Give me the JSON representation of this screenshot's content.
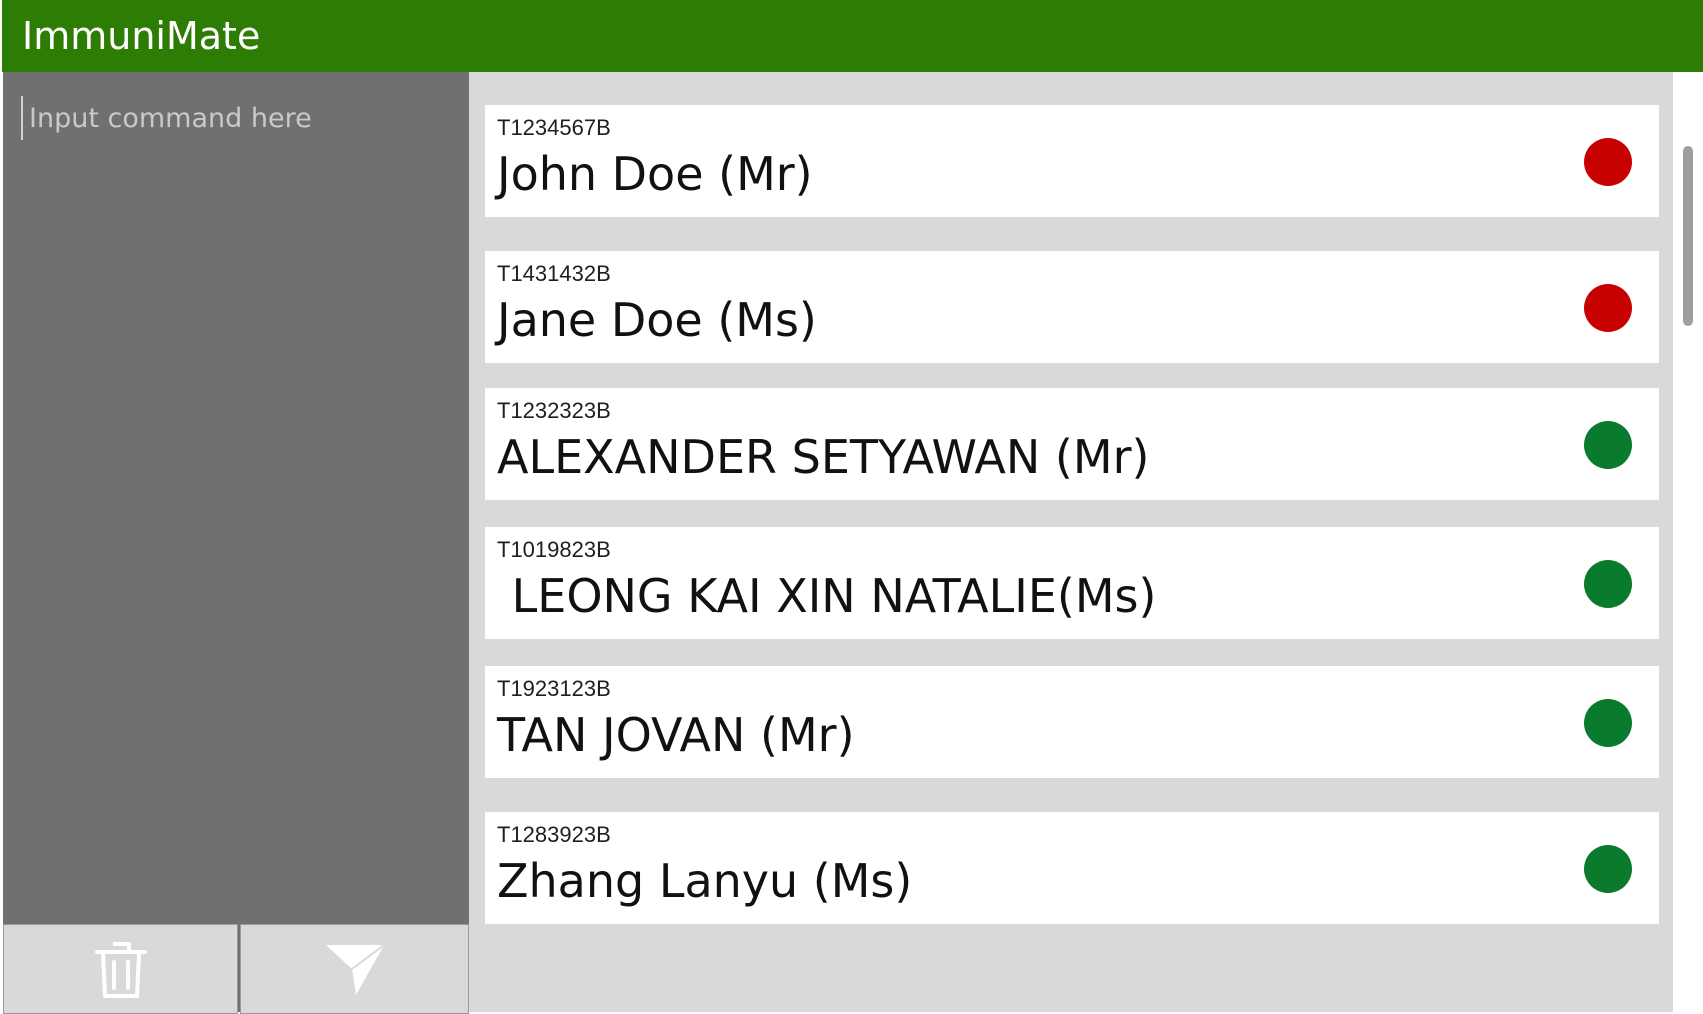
{
  "app": {
    "title": "ImmuniMate"
  },
  "command": {
    "placeholder": "Input command here",
    "value": ""
  },
  "buttons": {
    "clear_icon": "trash-icon",
    "send_icon": "send-icon"
  },
  "colors": {
    "titlebar": "#2d7c03",
    "status_red": "#c70000",
    "status_green": "#0a7a2d"
  },
  "patients": [
    {
      "id": "T1234567B",
      "name": "John Doe (Mr)",
      "status": "red"
    },
    {
      "id": "T1431432B",
      "name": "Jane Doe (Ms)",
      "status": "red"
    },
    {
      "id": "T1232323B",
      "name": "ALEXANDER SETYAWAN (Mr)",
      "status": "green"
    },
    {
      "id": "T1019823B",
      "name": " LEONG KAI XIN NATALIE(Ms)",
      "status": "green"
    },
    {
      "id": "T1923123B",
      "name": "TAN JOVAN (Mr)",
      "status": "green"
    },
    {
      "id": "T1283923B",
      "name": "Zhang Lanyu (Ms)",
      "status": "green"
    }
  ]
}
